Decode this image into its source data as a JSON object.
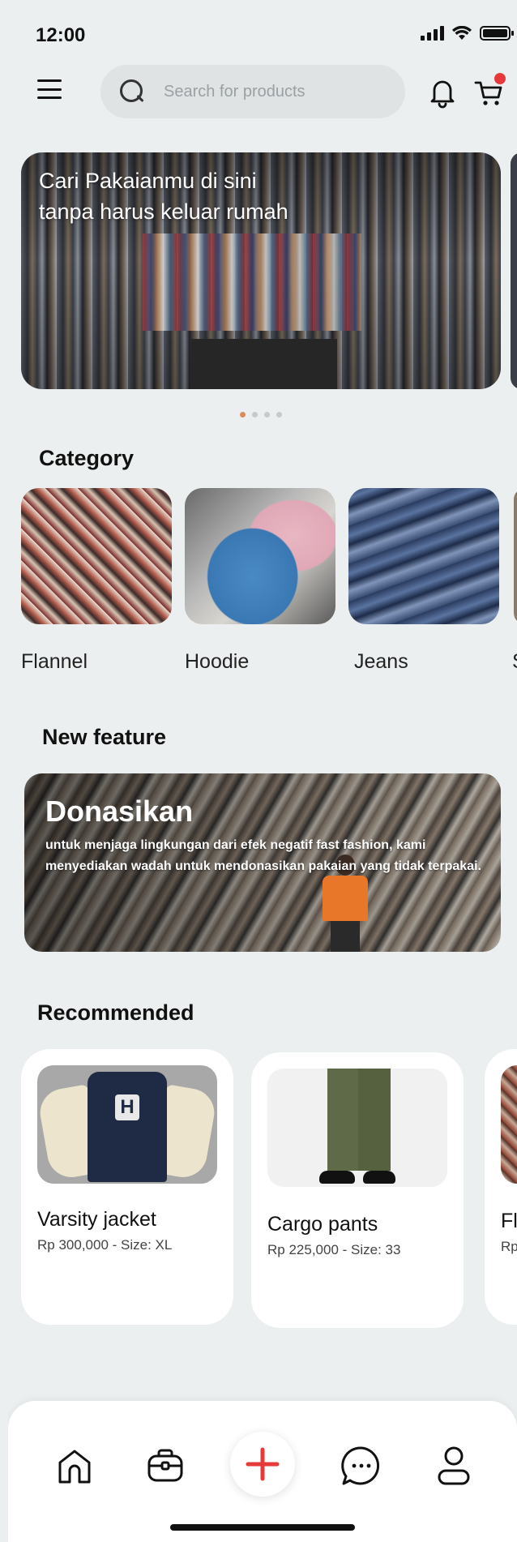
{
  "status_bar": {
    "time": "12:00"
  },
  "search": {
    "placeholder": "Search for products"
  },
  "cart": {
    "badge_color": "#e63a3a"
  },
  "banner": {
    "text": "Cari Pakaianmu di sini tanpa harus keluar rumah",
    "dots": 4,
    "active_dot": 0
  },
  "category": {
    "title": "Category",
    "items": [
      {
        "label": "Flannel"
      },
      {
        "label": "Hoodie"
      },
      {
        "label": "Jeans"
      },
      {
        "label": "S"
      }
    ]
  },
  "new_feature": {
    "title": "New feature",
    "card_title": "Donasikan",
    "card_desc": "untuk menjaga lingkungan dari efek negatif fast fashion, kami menyediakan wadah untuk mendonasikan pakaian yang tidak terpakai."
  },
  "recommended": {
    "title": "Recommended",
    "items": [
      {
        "name": "Varsity jacket",
        "meta": "Rp 300,000 - Size: XL"
      },
      {
        "name": "Cargo pants",
        "meta": "Rp 225,000 - Size: 33"
      },
      {
        "name": "Fla",
        "meta": "Rp"
      }
    ]
  },
  "nav": {
    "items": [
      "home-icon",
      "briefcase-icon",
      "plus-icon",
      "chat-icon",
      "profile-icon"
    ],
    "accent": "#e63a3a"
  },
  "colors": {
    "background": "#ecefef",
    "card": "#ffffff",
    "accent": "#e63a3a"
  }
}
